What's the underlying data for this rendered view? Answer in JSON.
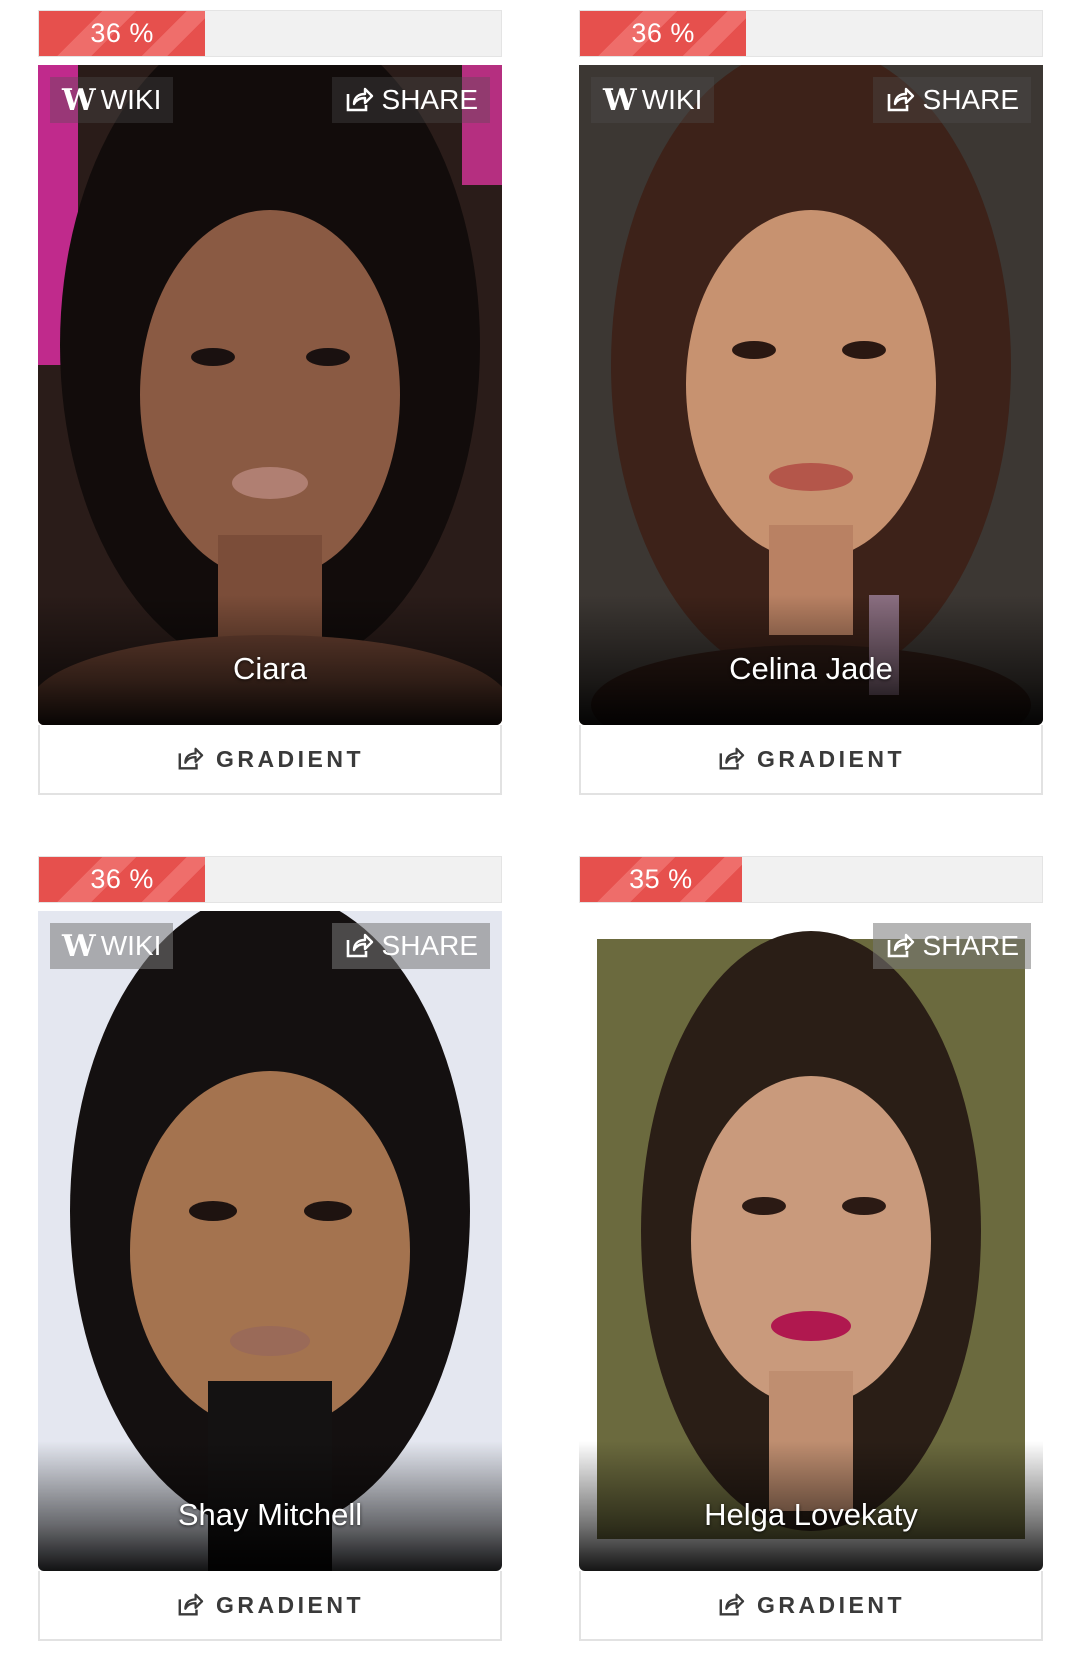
{
  "labels": {
    "wiki": "WIKI",
    "share": "SHARE",
    "gradient": "GRADIENT"
  },
  "cards": [
    {
      "match": "36 %",
      "match_fraction": 0.36,
      "name": "Ciara",
      "has_wiki": true
    },
    {
      "match": "36 %",
      "match_fraction": 0.36,
      "name": "Celina Jade",
      "has_wiki": true
    },
    {
      "match": "36 %",
      "match_fraction": 0.36,
      "name": "Shay Mitchell",
      "has_wiki": true
    },
    {
      "match": "35 %",
      "match_fraction": 0.35,
      "name": "Helga Lovekaty",
      "has_wiki": false
    }
  ],
  "colors": {
    "accent": "#e6504d",
    "bar_track": "#f1f1f1",
    "button_text": "#3a3a3a"
  },
  "icons": {
    "wiki": "wikipedia-icon",
    "share": "share-icon"
  }
}
